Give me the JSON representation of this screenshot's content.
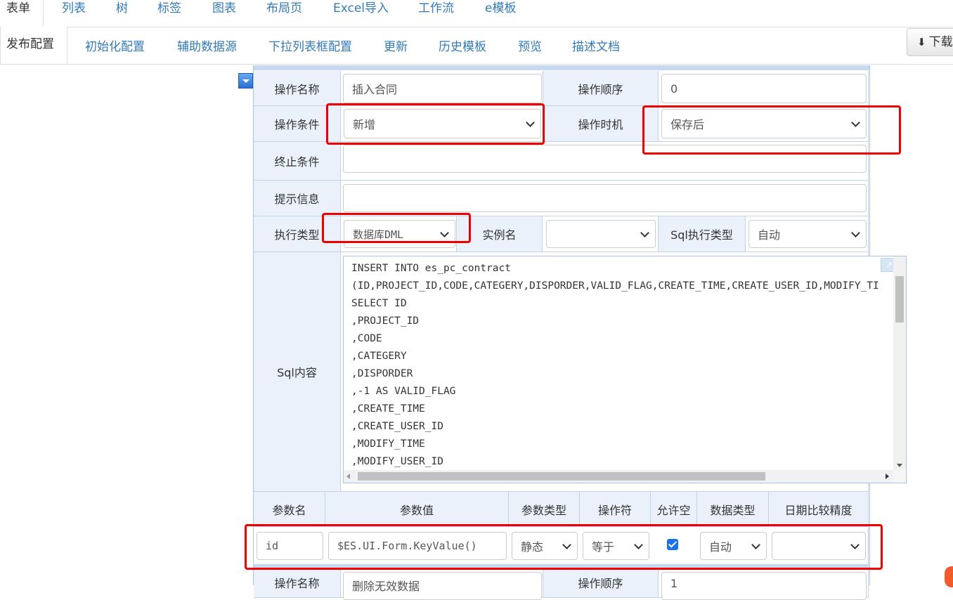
{
  "top_tabs": [
    "表单",
    "列表",
    "树",
    "标签",
    "图表",
    "布局页",
    "Excel导入",
    "工作流",
    "e模板"
  ],
  "sub_tabs": [
    "发布配置",
    "初始化配置",
    "辅助数据源",
    "下拉列表框配置",
    "更新",
    "历史模板",
    "预览",
    "描述文档"
  ],
  "download_label": "下载",
  "form": {
    "op_name_label": "操作名称",
    "op_name_value": "插入合同",
    "op_order_label": "操作顺序",
    "op_order_value": "0",
    "op_condition_label": "操作条件",
    "op_condition_value": "新增",
    "op_timing_label": "操作时机",
    "op_timing_value": "保存后",
    "stop_condition_label": "终止条件",
    "stop_condition_value": "",
    "hint_label": "提示信息",
    "hint_value": "",
    "exec_type_label": "执行类型",
    "exec_type_value": "数据库DML",
    "instance_label": "实例名",
    "instance_value": "",
    "sql_exec_type_label": "Sql执行类型",
    "sql_exec_type_value": "自动",
    "sql_content_label": "Sql内容",
    "sql_lines": [
      "INSERT INTO es_pc_contract",
      "(ID,PROJECT_ID,CODE,CATEGERY,DISPORDER,VALID_FLAG,CREATE_TIME,CREATE_USER_ID,MODIFY_TI",
      "SELECT ID",
      ",PROJECT_ID",
      ",CODE",
      ",CATEGERY",
      ",DISPORDER",
      ",-1 AS VALID_FLAG",
      ",CREATE_TIME",
      ",CREATE_USER_ID",
      ",MODIFY_TIME",
      ",MODIFY_USER_ID"
    ]
  },
  "params": {
    "headers": [
      "参数名",
      "参数值",
      "参数类型",
      "操作符",
      "允许空",
      "数据类型",
      "日期比较精度"
    ],
    "row": {
      "name": "id",
      "value": "$ES.UI.Form.KeyValue()",
      "type": "静态",
      "operator": "等于",
      "allow_null": true,
      "data_type": "自动",
      "date_precision": ""
    }
  },
  "next_block": {
    "op_name_label": "操作名称",
    "op_name_value": "删除无效数据",
    "op_order_label": "操作顺序",
    "op_order_value": "1"
  },
  "colors": {
    "link": "#337ab7",
    "label_bg": "#eaf1fb",
    "annotation": "#ee0000"
  }
}
